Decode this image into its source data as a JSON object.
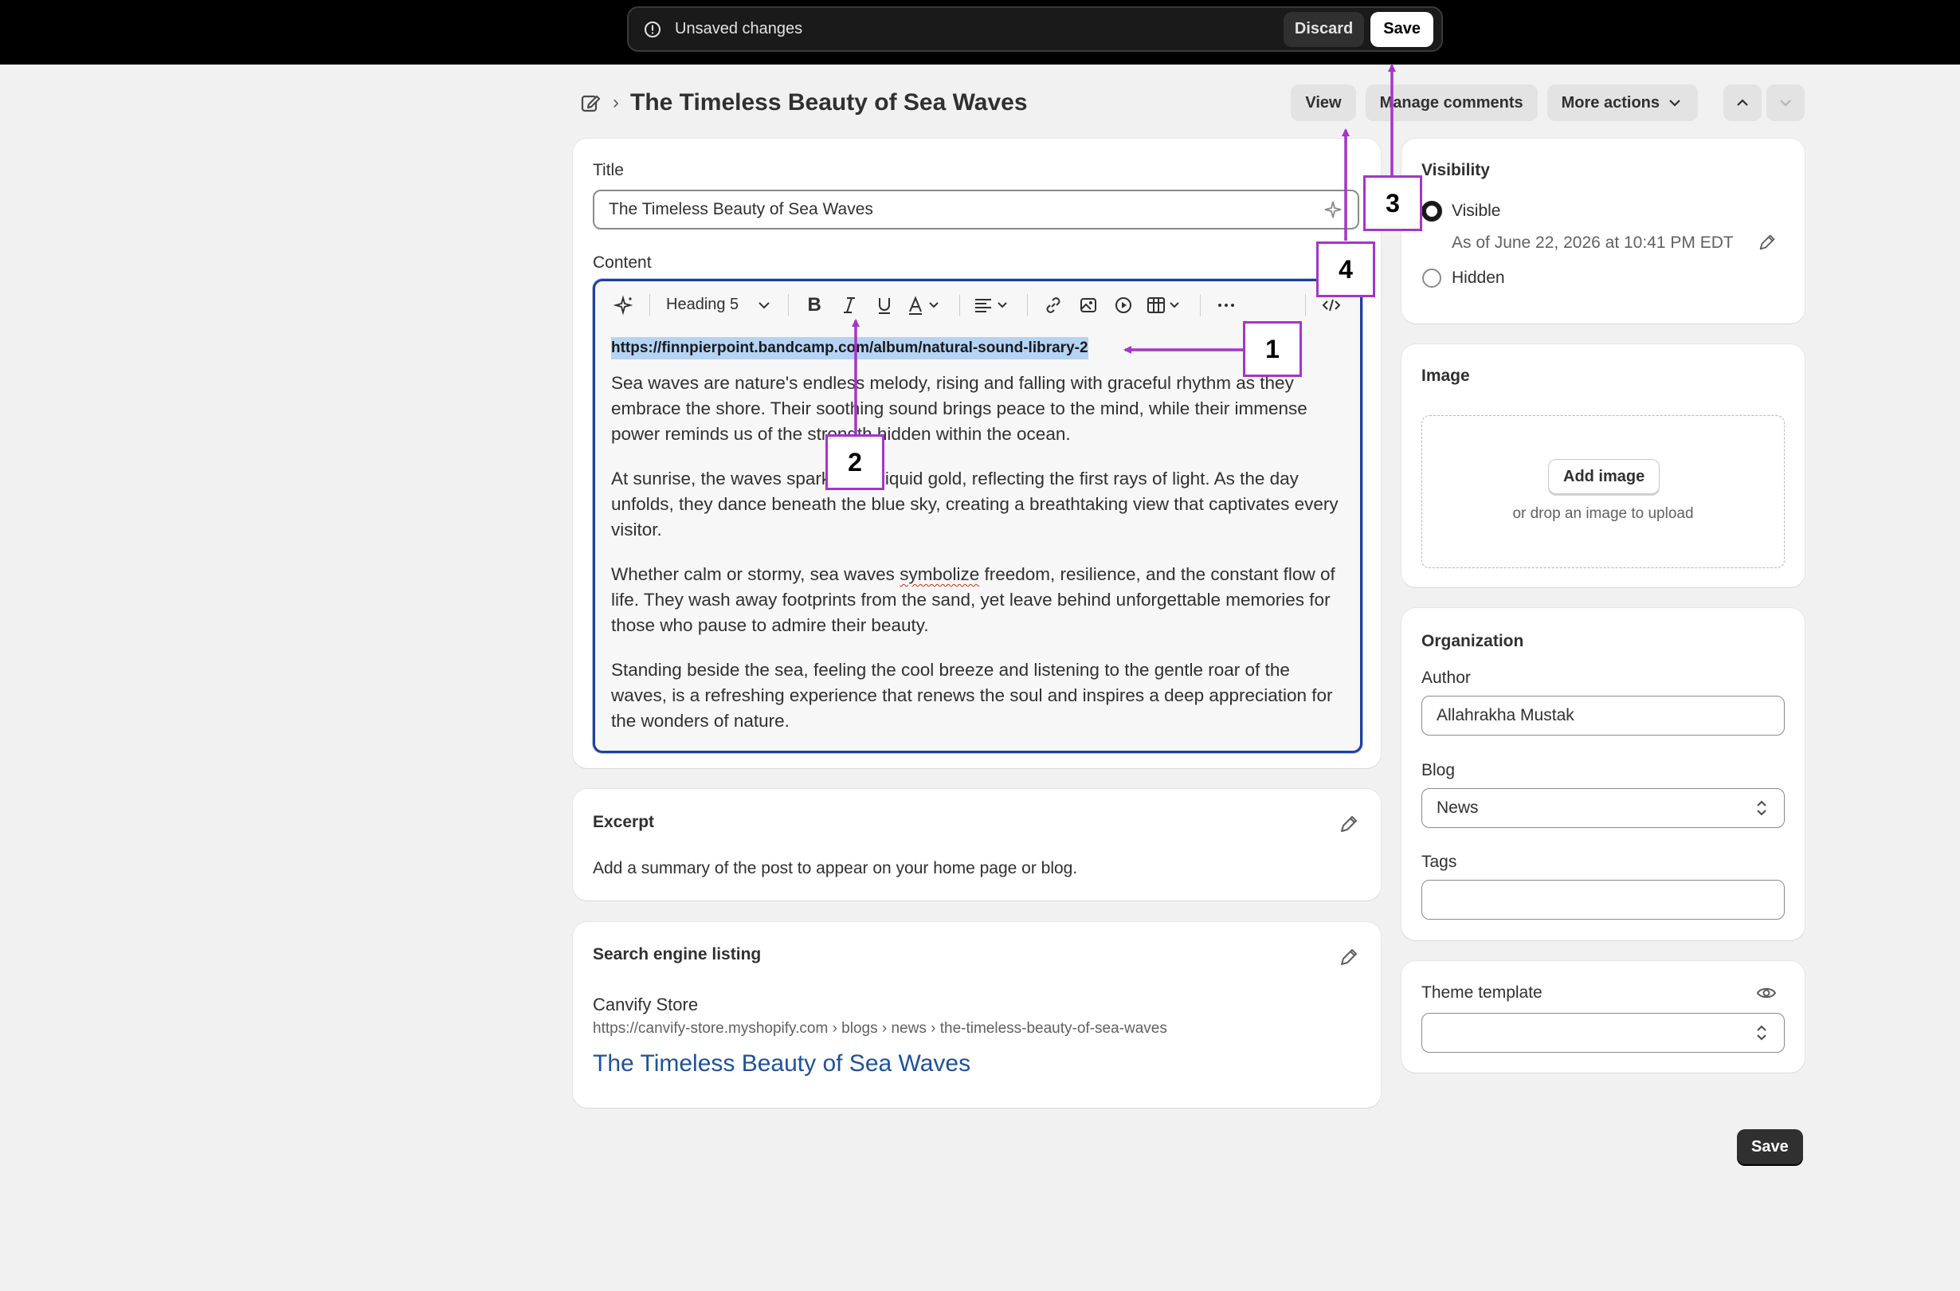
{
  "unsaved_bar": {
    "message": "Unsaved changes",
    "discard_label": "Discard",
    "save_label": "Save"
  },
  "header": {
    "title": "The Timeless Beauty of Sea Waves",
    "view_label": "View",
    "manage_comments_label": "Manage comments",
    "more_actions_label": "More actions"
  },
  "main": {
    "title_label": "Title",
    "title_value": "The Timeless Beauty of Sea Waves",
    "content_label": "Content",
    "toolbar": {
      "heading_select": "Heading 5"
    },
    "content": {
      "link": "https://finnpierpoint.bandcamp.com/album/natural-sound-library-2",
      "p1": "Sea waves are nature's endless melody, rising and falling with graceful rhythm as they embrace the shore. Their soothing sound brings peace to the mind, while their immense power reminds us of the strength hidden within the ocean.",
      "p2": "At sunrise, the waves sparkle like liquid gold, reflecting the first rays of light. As the day unfolds, they dance beneath the blue sky, creating a breathtaking view that captivates every visitor.",
      "p3_before": "Whether calm or stormy, sea waves ",
      "p3_word": "symbolize",
      "p3_after": " freedom, resilience, and the constant flow of life. They wash away footprints from the sand, yet leave behind unforgettable memories for those who pause to admire their beauty.",
      "p4": "Standing beside the sea, feeling the cool breeze and listening to the gentle roar of the waves, is a refreshing experience that renews the soul and inspires a deep appreciation for the wonders of nature."
    }
  },
  "excerpt": {
    "title": "Excerpt",
    "description": "Add a summary of the post to appear on your home page or blog."
  },
  "seo": {
    "title": "Search engine listing",
    "store_name": "Canvify Store",
    "url": "https://canvify-store.myshopify.com › blogs › news › the-timeless-beauty-of-sea-waves",
    "link_title": "The Timeless Beauty of Sea Waves"
  },
  "visibility": {
    "title": "Visibility",
    "visible_label": "Visible",
    "visible_date": "As of June 22, 2026 at 10:41 PM EDT",
    "hidden_label": "Hidden"
  },
  "image": {
    "title": "Image",
    "add_label": "Add image",
    "drop_hint": "or drop an image to upload"
  },
  "organization": {
    "title": "Organization",
    "author_label": "Author",
    "author_value": "Allahrakha Mustak",
    "blog_label": "Blog",
    "blog_value": "News",
    "tags_label": "Tags",
    "tags_value": ""
  },
  "theme": {
    "title": "Theme template",
    "value": ""
  },
  "footer": {
    "save_label": "Save"
  },
  "annotations": {
    "a1": "1",
    "a2": "2",
    "a3": "3",
    "a4": "4"
  },
  "colors": {
    "accent": "#a535c7",
    "link_blue": "#1f5199",
    "focus": "#1f3f9f",
    "selection": "#b4d3f5"
  }
}
